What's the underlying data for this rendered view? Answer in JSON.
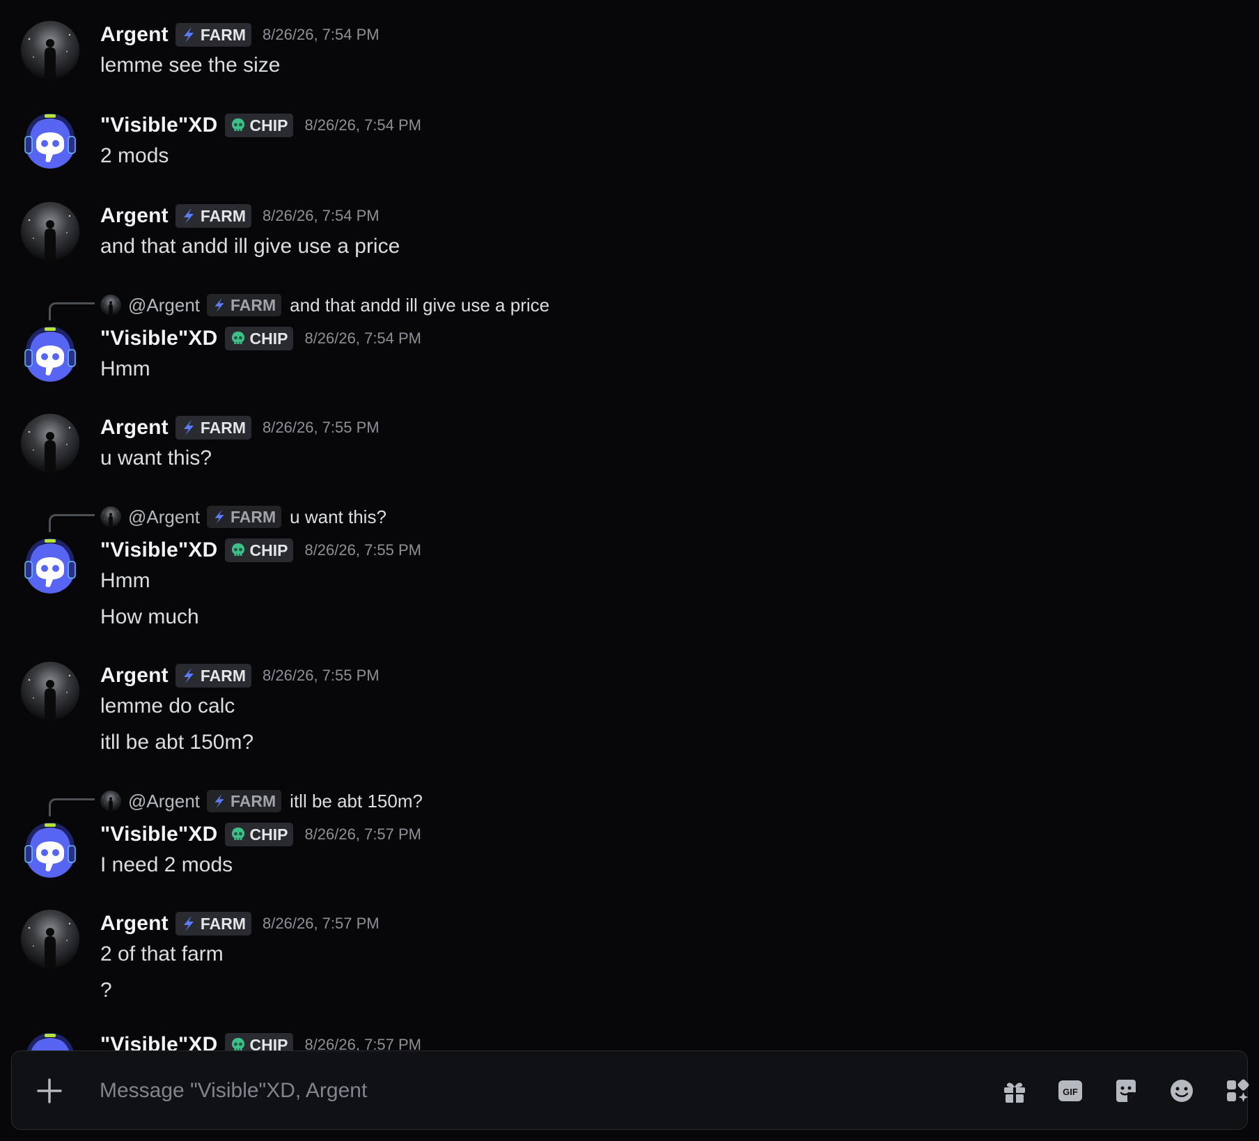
{
  "conversation": {
    "messages": [
      {
        "type": "full",
        "author": "argent",
        "name": "Argent",
        "tag": "FARM",
        "timestamp": "8/26/26, 7:54 PM",
        "lines": [
          "lemme see the size"
        ]
      },
      {
        "type": "full",
        "author": "visible",
        "name": "\"Visible\"XD",
        "tag": "CHIP",
        "timestamp": "8/26/26, 7:54 PM",
        "lines": [
          "2 mods"
        ]
      },
      {
        "type": "full",
        "author": "argent",
        "name": "Argent",
        "tag": "FARM",
        "timestamp": "8/26/26, 7:54 PM",
        "lines": [
          "and that andd ill give use a price"
        ]
      },
      {
        "type": "reply",
        "author": "visible",
        "name": "\"Visible\"XD",
        "tag": "CHIP",
        "timestamp": "8/26/26, 7:54 PM",
        "reply_to": {
          "user": "@Argent",
          "tag": "FARM",
          "text": "and that andd ill give use a price"
        },
        "lines": [
          "Hmm"
        ]
      },
      {
        "type": "full",
        "author": "argent",
        "name": "Argent",
        "tag": "FARM",
        "timestamp": "8/26/26, 7:55 PM",
        "lines": [
          "u want this?"
        ]
      },
      {
        "type": "reply",
        "author": "visible",
        "name": "\"Visible\"XD",
        "tag": "CHIP",
        "timestamp": "8/26/26, 7:55 PM",
        "reply_to": {
          "user": "@Argent",
          "tag": "FARM",
          "text": "u want this?"
        },
        "lines": [
          "Hmm",
          "How much"
        ]
      },
      {
        "type": "full",
        "author": "argent",
        "name": "Argent",
        "tag": "FARM",
        "timestamp": "8/26/26, 7:55 PM",
        "lines": [
          "lemme do calc",
          "itll be abt 150m?"
        ]
      },
      {
        "type": "reply",
        "author": "visible",
        "name": "\"Visible\"XD",
        "tag": "CHIP",
        "timestamp": "8/26/26, 7:57 PM",
        "reply_to": {
          "user": "@Argent",
          "tag": "FARM",
          "text": "itll be abt 150m?"
        },
        "lines": [
          "I need 2 mods"
        ]
      },
      {
        "type": "full",
        "author": "argent",
        "name": "Argent",
        "tag": "FARM",
        "timestamp": "8/26/26, 7:57 PM",
        "lines": [
          "2 of that farm",
          "?"
        ]
      },
      {
        "type": "full",
        "author": "visible",
        "name": "\"Visible\"XD",
        "tag": "CHIP",
        "timestamp": "8/26/26, 7:57 PM",
        "lines": []
      }
    ]
  },
  "composer": {
    "placeholder": "Message \"Visible\"XD, Argent",
    "icons": [
      "plus-icon",
      "gift-icon",
      "gif-icon",
      "sticker-icon",
      "emoji-icon",
      "apps-icon"
    ],
    "gif_label": "GIF"
  },
  "colors": {
    "background": "#070709",
    "blurple": "#5865f2",
    "farm_bolt": "#5b7cf6",
    "chip_skull": "#3fbf8a"
  }
}
